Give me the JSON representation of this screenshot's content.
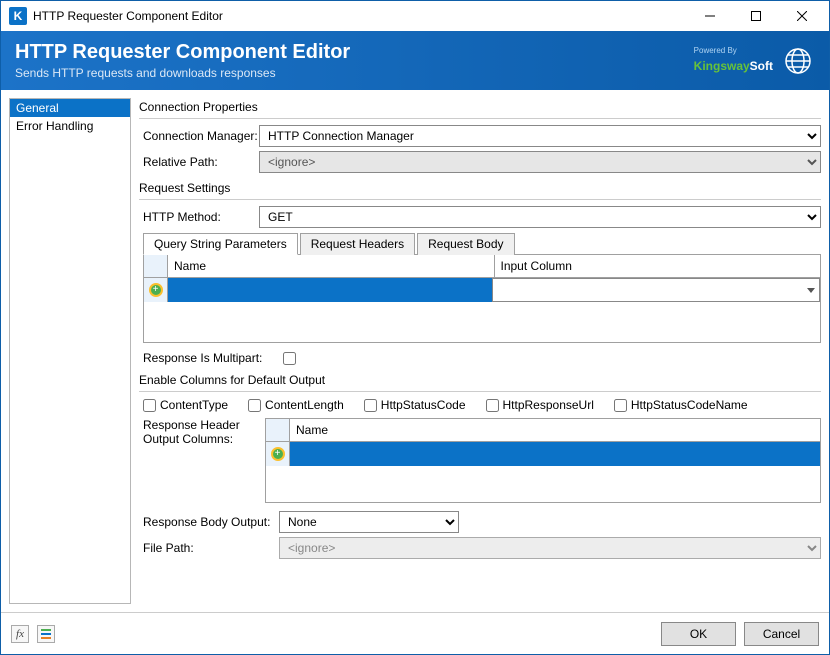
{
  "titlebar": {
    "title": "HTTP Requester Component Editor"
  },
  "header": {
    "title": "HTTP Requester Component Editor",
    "subtitle": "Sends HTTP requests and downloads responses",
    "powered_by": "Powered By",
    "brand_prefix": "Kingsway",
    "brand_suffix": "Soft"
  },
  "sidebar": {
    "items": [
      "General",
      "Error Handling"
    ],
    "selected": 0
  },
  "connection_properties": {
    "group_title": "Connection Properties",
    "conn_mgr_label": "Connection Manager:",
    "conn_mgr_value": "HTTP Connection Manager",
    "relative_path_label": "Relative Path:",
    "relative_path_value": "<ignore>"
  },
  "request_settings": {
    "group_title": "Request Settings",
    "http_method_label": "HTTP Method:",
    "http_method_value": "GET",
    "tabs": [
      "Query String Parameters",
      "Request Headers",
      "Request Body"
    ],
    "active_tab": 0,
    "grid_col_name": "Name",
    "grid_col_input": "Input Column",
    "response_is_multipart_label": "Response Is Multipart:"
  },
  "output": {
    "group_title": "Enable Columns for Default Output",
    "checkboxes": [
      "ContentType",
      "ContentLength",
      "HttpStatusCode",
      "HttpResponseUrl",
      "HttpStatusCodeName"
    ],
    "response_header_label": "Response Header Output Columns:",
    "grid_col_name": "Name",
    "response_body_output_label": "Response Body Output:",
    "response_body_output_value": "None",
    "file_path_label": "File Path:",
    "file_path_value": "<ignore>"
  },
  "buttons": {
    "ok": "OK",
    "cancel": "Cancel"
  }
}
